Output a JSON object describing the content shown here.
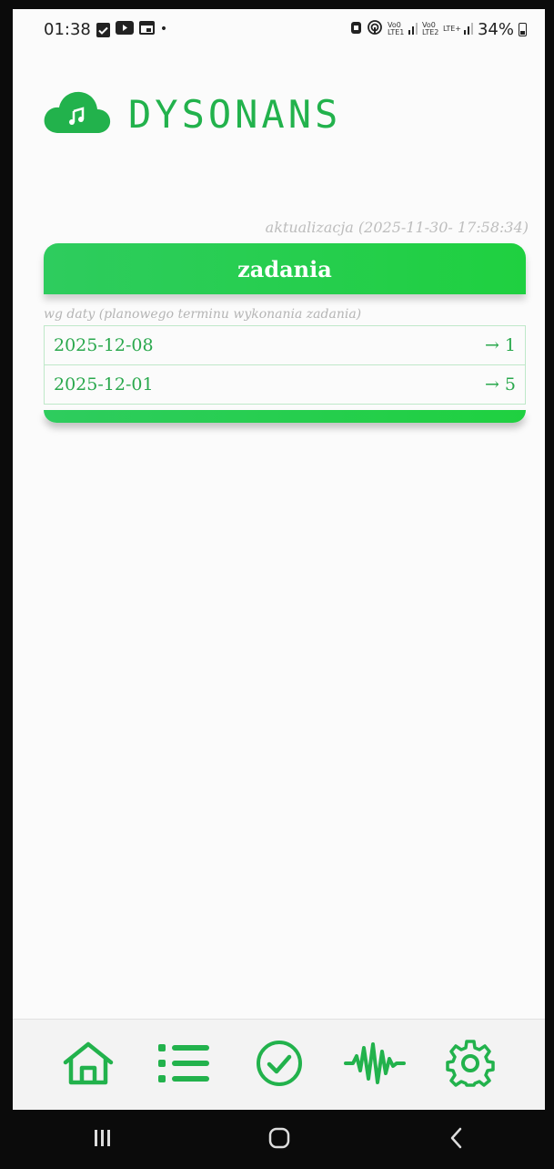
{
  "status_bar": {
    "time": "01:38",
    "network_labels": [
      "Vo0 LTE1",
      "Vo0 LTE2"
    ],
    "lte_plus": "LTE+",
    "battery": "34%"
  },
  "app": {
    "brand": "DYSONANS"
  },
  "updated": "aktualizacja (2025-11-30- 17:58:34)",
  "tasks_card": {
    "title": "zadania",
    "subtitle": "wg daty (planowego terminu wykonania zadania)",
    "rows": [
      {
        "date": "2025-12-08",
        "count": "→ 1"
      },
      {
        "date": "2025-12-01",
        "count": "→ 5"
      }
    ]
  },
  "bottom_nav": {
    "items": [
      "home-icon",
      "list-icon",
      "check-circle-icon",
      "waveform-icon",
      "gear-icon"
    ],
    "accent": "#22b24c"
  },
  "system_nav": [
    "recents",
    "home",
    "back"
  ]
}
